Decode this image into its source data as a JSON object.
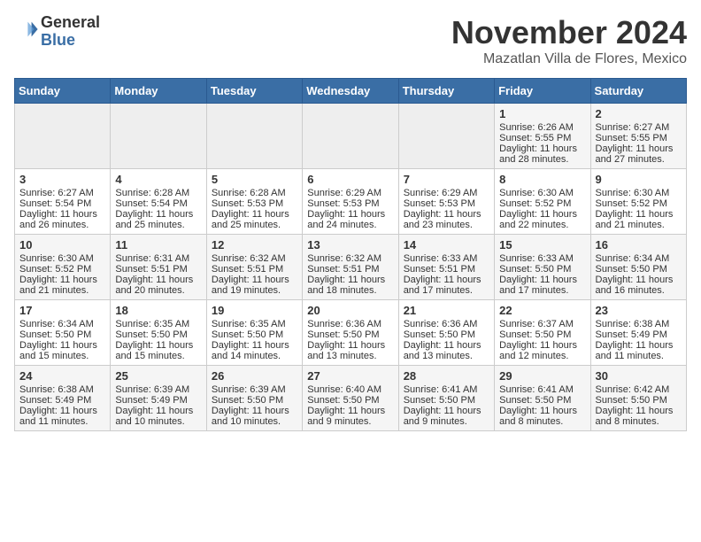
{
  "header": {
    "logo": {
      "general": "General",
      "blue": "Blue"
    },
    "title": "November 2024",
    "subtitle": "Mazatlan Villa de Flores, Mexico"
  },
  "weekdays": [
    "Sunday",
    "Monday",
    "Tuesday",
    "Wednesday",
    "Thursday",
    "Friday",
    "Saturday"
  ],
  "weeks": [
    [
      {
        "day": "",
        "empty": true
      },
      {
        "day": "",
        "empty": true
      },
      {
        "day": "",
        "empty": true
      },
      {
        "day": "",
        "empty": true
      },
      {
        "day": "",
        "empty": true
      },
      {
        "day": "1",
        "sunrise": "6:26 AM",
        "sunset": "5:55 PM",
        "daylight": "11 hours and 28 minutes."
      },
      {
        "day": "2",
        "sunrise": "6:27 AM",
        "sunset": "5:55 PM",
        "daylight": "11 hours and 27 minutes."
      }
    ],
    [
      {
        "day": "3",
        "sunrise": "6:27 AM",
        "sunset": "5:54 PM",
        "daylight": "11 hours and 26 minutes."
      },
      {
        "day": "4",
        "sunrise": "6:28 AM",
        "sunset": "5:54 PM",
        "daylight": "11 hours and 25 minutes."
      },
      {
        "day": "5",
        "sunrise": "6:28 AM",
        "sunset": "5:53 PM",
        "daylight": "11 hours and 25 minutes."
      },
      {
        "day": "6",
        "sunrise": "6:29 AM",
        "sunset": "5:53 PM",
        "daylight": "11 hours and 24 minutes."
      },
      {
        "day": "7",
        "sunrise": "6:29 AM",
        "sunset": "5:53 PM",
        "daylight": "11 hours and 23 minutes."
      },
      {
        "day": "8",
        "sunrise": "6:30 AM",
        "sunset": "5:52 PM",
        "daylight": "11 hours and 22 minutes."
      },
      {
        "day": "9",
        "sunrise": "6:30 AM",
        "sunset": "5:52 PM",
        "daylight": "11 hours and 21 minutes."
      }
    ],
    [
      {
        "day": "10",
        "sunrise": "6:30 AM",
        "sunset": "5:52 PM",
        "daylight": "11 hours and 21 minutes."
      },
      {
        "day": "11",
        "sunrise": "6:31 AM",
        "sunset": "5:51 PM",
        "daylight": "11 hours and 20 minutes."
      },
      {
        "day": "12",
        "sunrise": "6:32 AM",
        "sunset": "5:51 PM",
        "daylight": "11 hours and 19 minutes."
      },
      {
        "day": "13",
        "sunrise": "6:32 AM",
        "sunset": "5:51 PM",
        "daylight": "11 hours and 18 minutes."
      },
      {
        "day": "14",
        "sunrise": "6:33 AM",
        "sunset": "5:51 PM",
        "daylight": "11 hours and 17 minutes."
      },
      {
        "day": "15",
        "sunrise": "6:33 AM",
        "sunset": "5:50 PM",
        "daylight": "11 hours and 17 minutes."
      },
      {
        "day": "16",
        "sunrise": "6:34 AM",
        "sunset": "5:50 PM",
        "daylight": "11 hours and 16 minutes."
      }
    ],
    [
      {
        "day": "17",
        "sunrise": "6:34 AM",
        "sunset": "5:50 PM",
        "daylight": "11 hours and 15 minutes."
      },
      {
        "day": "18",
        "sunrise": "6:35 AM",
        "sunset": "5:50 PM",
        "daylight": "11 hours and 15 minutes."
      },
      {
        "day": "19",
        "sunrise": "6:35 AM",
        "sunset": "5:50 PM",
        "daylight": "11 hours and 14 minutes."
      },
      {
        "day": "20",
        "sunrise": "6:36 AM",
        "sunset": "5:50 PM",
        "daylight": "11 hours and 13 minutes."
      },
      {
        "day": "21",
        "sunrise": "6:36 AM",
        "sunset": "5:50 PM",
        "daylight": "11 hours and 13 minutes."
      },
      {
        "day": "22",
        "sunrise": "6:37 AM",
        "sunset": "5:50 PM",
        "daylight": "11 hours and 12 minutes."
      },
      {
        "day": "23",
        "sunrise": "6:38 AM",
        "sunset": "5:49 PM",
        "daylight": "11 hours and 11 minutes."
      }
    ],
    [
      {
        "day": "24",
        "sunrise": "6:38 AM",
        "sunset": "5:49 PM",
        "daylight": "11 hours and 11 minutes."
      },
      {
        "day": "25",
        "sunrise": "6:39 AM",
        "sunset": "5:49 PM",
        "daylight": "11 hours and 10 minutes."
      },
      {
        "day": "26",
        "sunrise": "6:39 AM",
        "sunset": "5:50 PM",
        "daylight": "11 hours and 10 minutes."
      },
      {
        "day": "27",
        "sunrise": "6:40 AM",
        "sunset": "5:50 PM",
        "daylight": "11 hours and 9 minutes."
      },
      {
        "day": "28",
        "sunrise": "6:41 AM",
        "sunset": "5:50 PM",
        "daylight": "11 hours and 9 minutes."
      },
      {
        "day": "29",
        "sunrise": "6:41 AM",
        "sunset": "5:50 PM",
        "daylight": "11 hours and 8 minutes."
      },
      {
        "day": "30",
        "sunrise": "6:42 AM",
        "sunset": "5:50 PM",
        "daylight": "11 hours and 8 minutes."
      }
    ]
  ]
}
